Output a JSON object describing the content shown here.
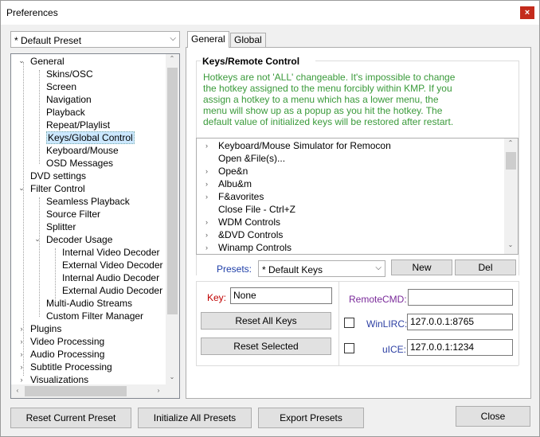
{
  "window": {
    "title": "Preferences",
    "close_glyph": "×"
  },
  "preset_combo": {
    "value": "* Default Preset"
  },
  "tree": {
    "items": [
      {
        "label": "General",
        "level": 0,
        "twisty": "open"
      },
      {
        "label": "Skins/OSC",
        "level": 1
      },
      {
        "label": "Screen",
        "level": 1
      },
      {
        "label": "Navigation",
        "level": 1
      },
      {
        "label": "Playback",
        "level": 1
      },
      {
        "label": "Repeat/Playlist",
        "level": 1
      },
      {
        "label": "Keys/Global Control",
        "level": 1,
        "selected": true
      },
      {
        "label": "Keyboard/Mouse",
        "level": 1
      },
      {
        "label": "OSD Messages",
        "level": 1
      },
      {
        "label": "DVD settings",
        "level": 0
      },
      {
        "label": "Filter Control",
        "level": 0,
        "twisty": "open"
      },
      {
        "label": "Seamless Playback",
        "level": 1
      },
      {
        "label": "Source Filter",
        "level": 1
      },
      {
        "label": "Splitter",
        "level": 1
      },
      {
        "label": "Decoder Usage",
        "level": 1,
        "twisty": "open"
      },
      {
        "label": "Internal Video Decoder",
        "level": 2
      },
      {
        "label": "External Video Decoder",
        "level": 2
      },
      {
        "label": "Internal Audio Decoder",
        "level": 2
      },
      {
        "label": "External Audio Decoder",
        "level": 2
      },
      {
        "label": "Multi-Audio Streams",
        "level": 1
      },
      {
        "label": "Custom Filter Manager",
        "level": 1
      },
      {
        "label": "Plugins",
        "level": 0,
        "twisty": "closed"
      },
      {
        "label": "Video Processing",
        "level": 0,
        "twisty": "closed"
      },
      {
        "label": "Audio Processing",
        "level": 0,
        "twisty": "closed"
      },
      {
        "label": "Subtitle Processing",
        "level": 0,
        "twisty": "closed"
      },
      {
        "label": "Visualizations",
        "level": 0,
        "twisty": "closed"
      }
    ]
  },
  "tabs": [
    {
      "label": "General",
      "active": true
    },
    {
      "label": "Global",
      "active": false
    }
  ],
  "keys_group": {
    "title": "Keys/Remote Control",
    "note_lines": [
      "Hotkeys are not 'ALL' changeable. It's impossible to change",
      "the hotkey assigned to the menu forcibly within KMP. If you",
      "assign a hotkey to a menu which has a lower menu, the",
      "menu will show up as a popup as you hit the hotkey. The",
      "default value of initialized keys will be restored after restart."
    ]
  },
  "key_list": {
    "items": [
      {
        "label": "Keyboard/Mouse Simulator for Remocon",
        "expandable": true
      },
      {
        "label": "Open &File(s)...",
        "expandable": false
      },
      {
        "label": "Ope&n",
        "expandable": true
      },
      {
        "label": "Albu&m",
        "expandable": true
      },
      {
        "label": "F&avorites",
        "expandable": true
      },
      {
        "label": "Close File - Ctrl+Z",
        "expandable": false
      },
      {
        "label": "WDM Controls",
        "expandable": true
      },
      {
        "label": "&DVD Controls",
        "expandable": true
      },
      {
        "label": "Winamp Controls",
        "expandable": true
      }
    ]
  },
  "presets": {
    "label": "Presets:",
    "value": "* Default Keys",
    "new_label": "New",
    "del_label": "Del"
  },
  "key_field": {
    "label": "Key:",
    "value": "None"
  },
  "buttons": {
    "reset_all_keys": "Reset All Keys",
    "reset_selected": "Reset Selected"
  },
  "remote": {
    "remotecmd_label": "RemoteCMD:",
    "remotecmd_value": "",
    "winlirc_label": "WinLIRC:",
    "winlirc_value": "127.0.0.1:8765",
    "uice_label": "uICE:",
    "uice_value": "127.0.0.1:1234"
  },
  "footer": {
    "reset_preset": "Reset Current Preset",
    "init_presets": "Initialize All Presets",
    "export_presets": "Export Presets",
    "close": "Close"
  },
  "glyphs": {
    "combo_arrow": "⌵",
    "tree_open": "⌄",
    "tree_closed": "›",
    "list_closed": "›",
    "scroll_up": "⌃",
    "scroll_down": "⌄",
    "scroll_left": "‹",
    "scroll_right": "›"
  }
}
